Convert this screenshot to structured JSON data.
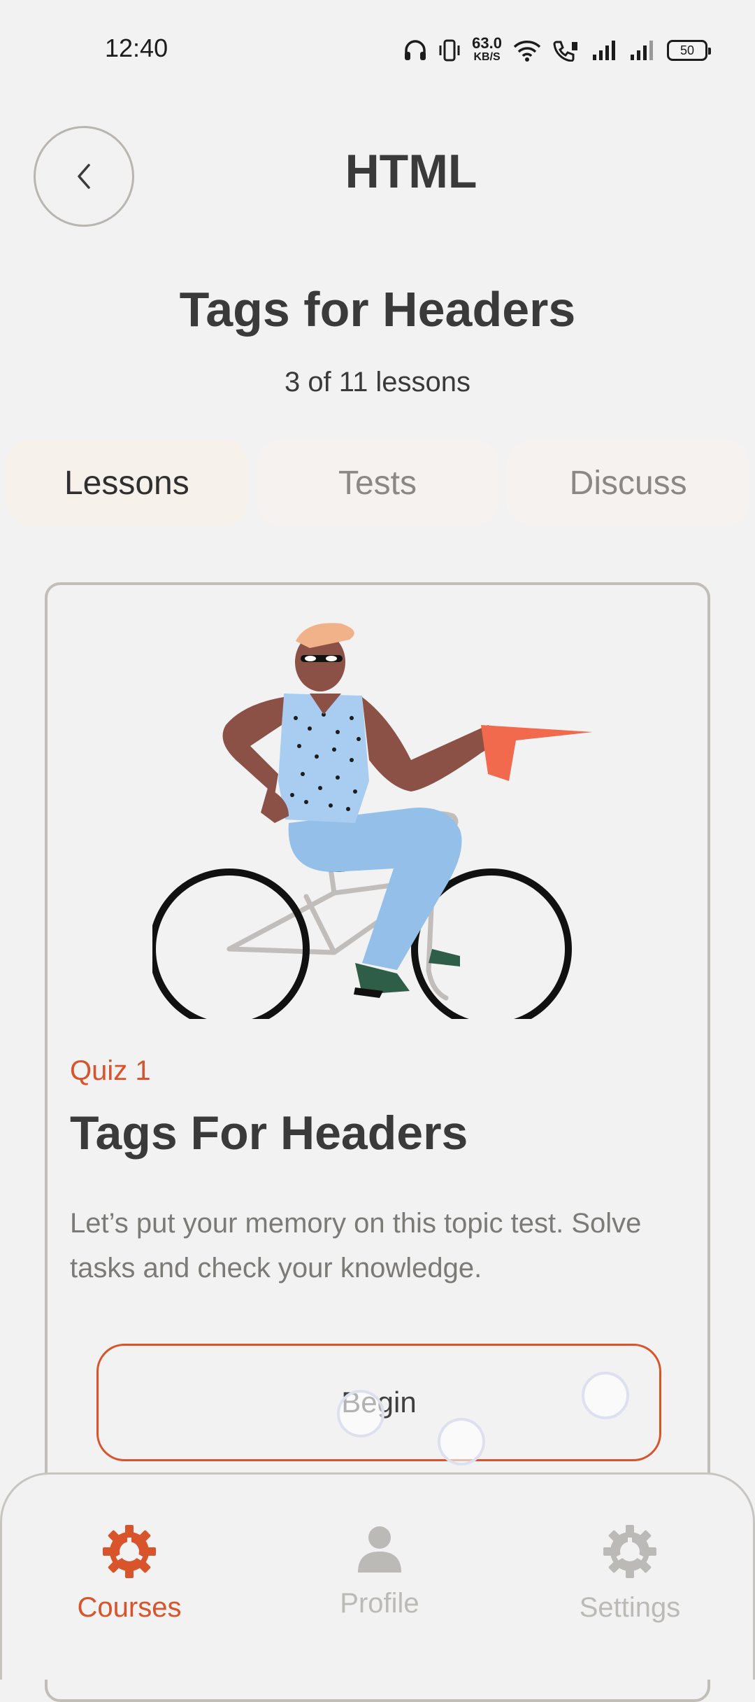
{
  "status_bar": {
    "time": "12:40",
    "net_speed_value": "63.0",
    "net_speed_unit": "KB/S",
    "battery": "50",
    "icons": [
      "headphones-icon",
      "vibrate-icon",
      "wifi-icon",
      "volte-call-icon",
      "signal-icon",
      "signal-icon-2",
      "battery-icon"
    ]
  },
  "header": {
    "back_icon": "chevron-left-icon",
    "title": "HTML"
  },
  "lesson": {
    "title": "Tags for Headers",
    "count_text": "3 of 11 lessons"
  },
  "tabs": [
    {
      "label": "Lessons",
      "active": true
    },
    {
      "label": "Tests",
      "active": false
    },
    {
      "label": "Discuss",
      "active": false
    }
  ],
  "card": {
    "illustration": "person-riding-bicycle-illustration",
    "quiz_label": "Quiz 1",
    "quiz_title": "Tags For Headers",
    "description": "Let’s put your memory on this topic test. Solve tasks and check your knowledge.",
    "button_label": "Begin"
  },
  "bottom_nav": [
    {
      "label": "Courses",
      "icon": "courses-gear-icon",
      "active": true
    },
    {
      "label": "Profile",
      "icon": "person-icon",
      "active": false
    },
    {
      "label": "Settings",
      "icon": "settings-gear-icon",
      "active": false
    }
  ],
  "colors": {
    "accent": "#d9542a",
    "background": "#f2f2f2",
    "text": "#3a3a3a",
    "muted": "#bcbab7",
    "border": "#c1bdb8"
  }
}
